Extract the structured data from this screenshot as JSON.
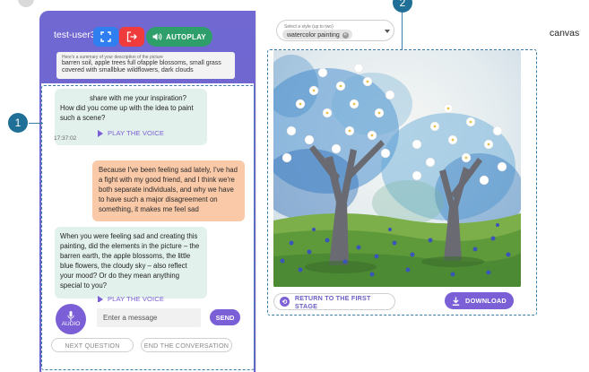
{
  "header": {
    "username": "test-user3",
    "autoplay_label": "AUTOPLAY"
  },
  "summary": {
    "label": "Here's a summary of your description of the picture",
    "text": "barren soil, apple trees full ofapple blossoms, small grass covered with smallblue wildflowers, dark clouds"
  },
  "chat": {
    "messages": [
      {
        "role": "bot",
        "text": "share with me your inspiration? How did you come up with the idea to paint such a scene?",
        "play_label": "PLAY THE VOICE"
      },
      {
        "role": "user",
        "text": "Because I've been feeling sad lately, I've had a fight with my good friend, and I think we're both separate individuals, and why we have to have such a major disagreement on something, it makes me feel sad"
      },
      {
        "role": "bot",
        "text": "When you were feeling sad and creating this painting, did the elements in the picture – the barren earth, the apple blossoms, the little blue flowers, the cloudy sky – also reflect your mood? Or do they mean anything special to you?",
        "play_label": "PLAY THE VOICE"
      }
    ],
    "timestamp": "17:37:02"
  },
  "composer": {
    "audio_label": "AUDIO",
    "placeholder": "Enter a message",
    "send_label": "SEND",
    "next_question_label": "NEXT QUESTION",
    "end_conversation_label": "END THE CONVERSATION"
  },
  "style_select": {
    "label": "Select a style (up to two)",
    "selected": "watercolor painting"
  },
  "canvas": {
    "label": "canvas",
    "return_label": "RETURN TO THE FIRST STAGE",
    "download_label": "DOWNLOAD"
  },
  "annotations": {
    "left_number": "1",
    "right_number": "2"
  },
  "colors": {
    "panel": "#6f66d0",
    "accent": "#7a5fd6",
    "bot_bubble": "#e2f1ec",
    "user_bubble": "#f9c9a8",
    "annotation": "#1f6f96"
  }
}
